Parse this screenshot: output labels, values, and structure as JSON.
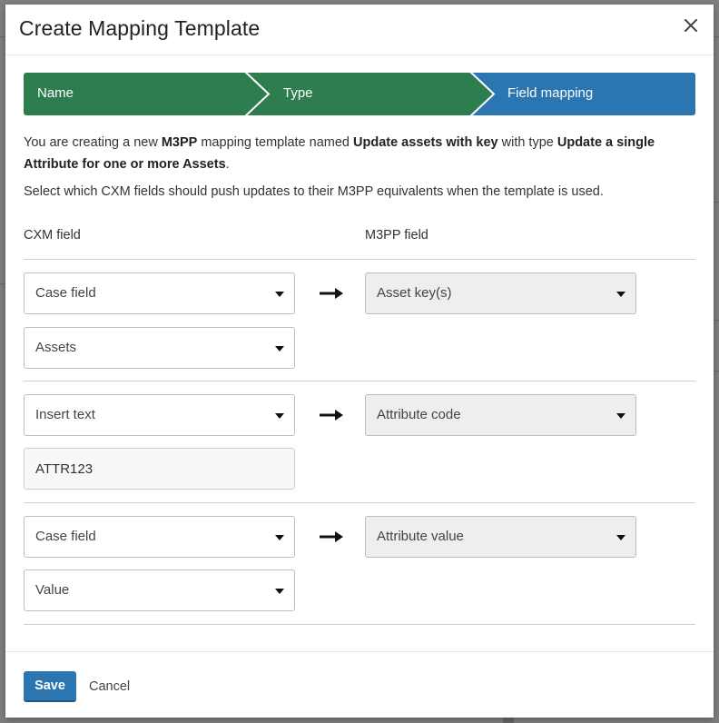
{
  "dialog": {
    "title": "Create Mapping Template",
    "close_icon": "close-icon"
  },
  "steps": [
    {
      "label": "Name",
      "state": "complete",
      "color": "#2e7d4f"
    },
    {
      "label": "Type",
      "state": "complete",
      "color": "#2e7d4f"
    },
    {
      "label": "Field mapping",
      "state": "active",
      "color": "#2b76b0"
    }
  ],
  "intro": {
    "prefix": "You are creating a new ",
    "system": "M3PP",
    "mid1": " mapping template named ",
    "template_name": "Update assets with key",
    "mid2": " with type ",
    "template_type": "Update a single Attribute for one or more Assets",
    "suffix": ".",
    "instruction": "Select which CXM fields should push updates to their M3PP equivalents when the template is used."
  },
  "columns": {
    "left": "CXM field",
    "right": "M3PP field"
  },
  "mappings": [
    {
      "source_type": "Case field",
      "source_detail": {
        "kind": "select",
        "value": "Assets"
      },
      "target": "Asset key(s)"
    },
    {
      "source_type": "Insert text",
      "source_detail": {
        "kind": "text",
        "value": "ATTR123"
      },
      "target": "Attribute code"
    },
    {
      "source_type": "Case field",
      "source_detail": {
        "kind": "select",
        "value": "Value"
      },
      "target": "Attribute value"
    }
  ],
  "footer": {
    "save_label": "Save",
    "cancel_label": "Cancel"
  },
  "colors": {
    "step_complete": "#2e7d4f",
    "step_active": "#2b76b0",
    "primary_button": "#2b75b0"
  }
}
